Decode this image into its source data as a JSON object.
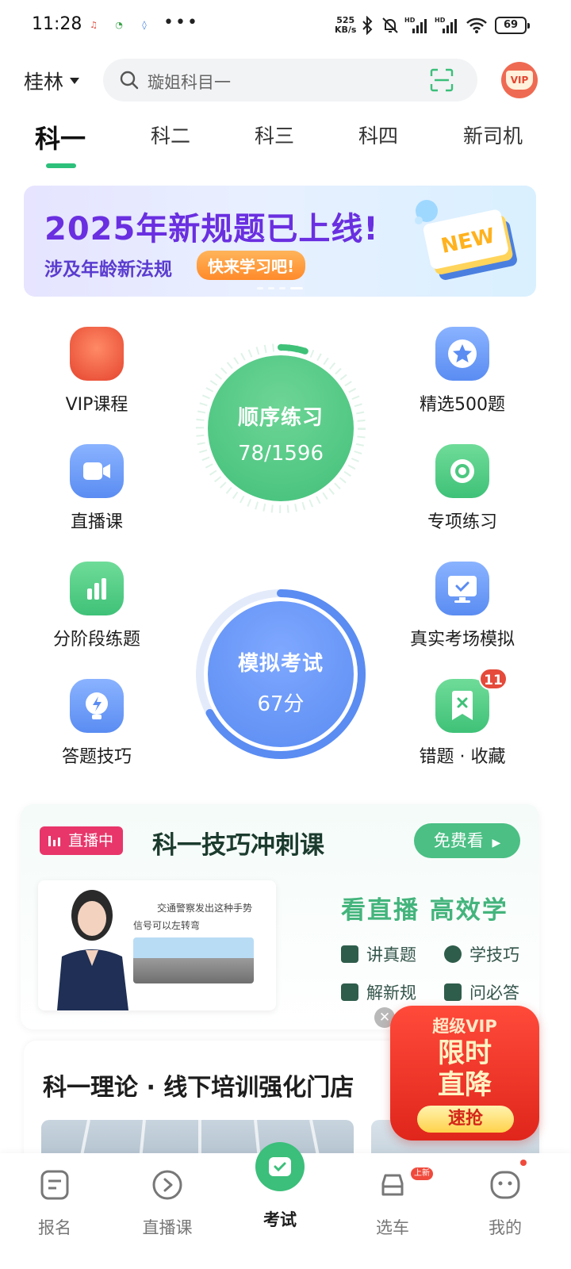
{
  "status_bar": {
    "time": "11:28",
    "net_speed_value": "525",
    "net_speed_unit": "KB/s",
    "battery": "69"
  },
  "header": {
    "city": "桂林",
    "search_placeholder": "璇姐科目一",
    "vip_label": "VIP"
  },
  "tabs": [
    {
      "label": "科一",
      "active": true
    },
    {
      "label": "科二"
    },
    {
      "label": "科三"
    },
    {
      "label": "科四"
    },
    {
      "label": "新司机"
    }
  ],
  "banner": {
    "title": "2025年新规题已上线!",
    "subtitle": "涉及年龄新法规",
    "button": "快来学习吧!",
    "art_text": "NEW"
  },
  "grid_left": [
    {
      "label": "VIP课程",
      "icon": "vip-course-icon"
    },
    {
      "label": "直播课",
      "icon": "video-camera-icon"
    },
    {
      "label": "分阶段练题",
      "icon": "bar-chart-icon"
    },
    {
      "label": "答题技巧",
      "icon": "lightbulb-icon"
    }
  ],
  "grid_right": [
    {
      "label": "精选500题",
      "icon": "star-icon"
    },
    {
      "label": "专项练习",
      "icon": "target-icon"
    },
    {
      "label": "真实考场模拟",
      "icon": "monitor-icon"
    },
    {
      "label": "错题 · 收藏",
      "icon": "bookmark-x-icon",
      "badge": "11"
    }
  ],
  "sequential_practice": {
    "title": "顺序练习",
    "progress": "78/1596",
    "done": 78,
    "total": 1596
  },
  "mock_exam": {
    "title": "模拟考试",
    "score": "67分",
    "score_value": 67,
    "max_score": 100
  },
  "live_card": {
    "tag": "直播中",
    "title": "科一技巧冲刺课",
    "free_button": "免费看",
    "slogan": "看直播 高效学",
    "thumb_caption": "交通警察发出这种手势",
    "thumb_caption2": "信号可以左转弯",
    "features": [
      "讲真题",
      "学技巧",
      "解新规",
      "问必答"
    ]
  },
  "store": {
    "title": "科一理论 · 线下培训强化门店"
  },
  "promo": {
    "line1": "超级VIP",
    "line2": "限时",
    "line3": "直降",
    "button": "速抢"
  },
  "bottom_nav": [
    {
      "label": "报名",
      "icon": "form-icon"
    },
    {
      "label": "直播课",
      "icon": "play-circle-icon"
    },
    {
      "label": "考试",
      "icon": "exam-check-icon",
      "active": true
    },
    {
      "label": "选车",
      "icon": "car-icon",
      "badge": "上新"
    },
    {
      "label": "我的",
      "icon": "smiley-icon",
      "dot": true
    }
  ],
  "colors": {
    "primary_green": "#3bbf7a",
    "exam_blue": "#5a8cf2",
    "live_pink": "#e8366a",
    "promo_red": "#e0261c"
  }
}
